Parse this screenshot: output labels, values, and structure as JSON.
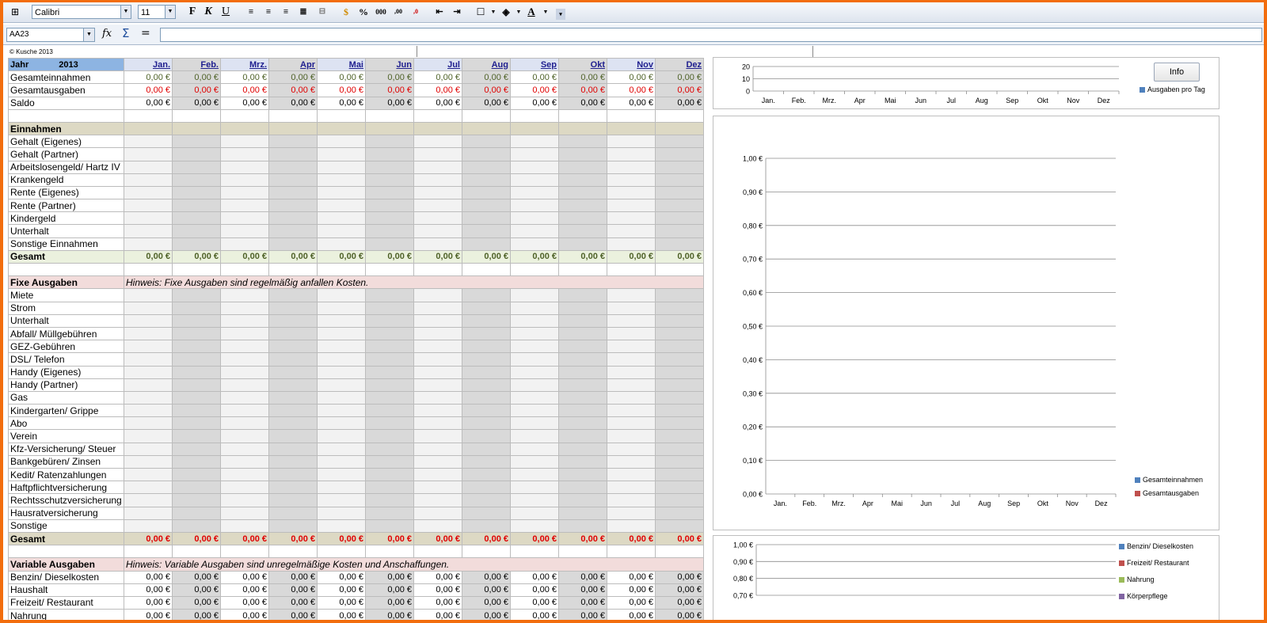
{
  "toolbar": {
    "font_name": "Calibri",
    "font_size": "11",
    "bold": "F",
    "italic": "K",
    "underline": "U"
  },
  "formula_bar": {
    "name_box": "AA23",
    "fx": "fx",
    "sigma": "Σ",
    "equals": "=",
    "formula": ""
  },
  "sheet": {
    "copyright": "© Kusche 2013",
    "year_label": "Jahr",
    "year": "2013",
    "months": [
      "Jan.",
      "Feb.",
      "Mrz.",
      "Apr",
      "Mai",
      "Jun",
      "Jul",
      "Aug",
      "Sep",
      "Okt",
      "Nov",
      "Dez"
    ],
    "zero": "0,00 €",
    "summary": [
      {
        "label": "Gesamteinnahmen",
        "color": "green"
      },
      {
        "label": "Gesamtausgaben",
        "color": "red"
      },
      {
        "label": "Saldo",
        "color": "black"
      }
    ],
    "einnahmen": {
      "title": "Einnahmen",
      "items": [
        "Gehalt (Eigenes)",
        "Gehalt  (Partner)",
        "Arbeitslosengeld/ Hartz IV",
        "Krankengeld",
        "Rente (Eigenes)",
        "Rente (Partner)",
        "Kindergeld",
        "Unterhalt",
        "Sonstige Einnahmen"
      ],
      "total": "Gesamt"
    },
    "fixe": {
      "title": "Fixe Ausgaben",
      "hint": "Hinweis: Fixe Ausgaben sind regelmäßig anfallen Kosten.",
      "items": [
        "Miete",
        "Strom",
        "Unterhalt",
        "Abfall/ Müllgebühren",
        "GEZ-Gebühren",
        "DSL/ Telefon",
        "Handy (Eigenes)",
        "Handy (Partner)",
        "Gas",
        "Kindergarten/ Grippe",
        "Abo",
        "Verein",
        "Kfz-Versicherung/ Steuer",
        "Bankgebüren/ Zinsen",
        "Kedit/ Ratenzahlungen",
        "Haftpflichtversicherung",
        "Rechtsschutzversicherung",
        "Hausratversicherung",
        "Sonstige"
      ],
      "total": "Gesamt"
    },
    "variable": {
      "title": "Variable Ausgaben",
      "hint": "Hinweis: Variable Ausgaben sind unregelmäßige Kosten und Anschaffungen.",
      "items": [
        "Benzin/ Dieselkosten",
        "Haushalt",
        "Freizeit/ Restaurant",
        "Nahrung",
        "Körperpflege"
      ]
    }
  },
  "info_button": "Info",
  "chart_data": [
    {
      "type": "bar",
      "categories": [
        "Jan.",
        "Feb.",
        "Mrz.",
        "Apr",
        "Mai",
        "Jun",
        "Jul",
        "Aug",
        "Sep",
        "Okt",
        "Nov",
        "Dez"
      ],
      "series": [
        {
          "name": "Ausgaben pro Tag",
          "values": [
            0,
            0,
            0,
            0,
            0,
            0,
            0,
            0,
            0,
            0,
            0,
            0
          ],
          "color": "#4f81bd"
        }
      ],
      "yticks": [
        "0",
        "10",
        "20"
      ],
      "ylim": [
        0,
        20
      ],
      "legend": "right"
    },
    {
      "type": "bar",
      "categories": [
        "Jan.",
        "Feb.",
        "Mrz.",
        "Apr",
        "Mai",
        "Jun",
        "Jul",
        "Aug",
        "Sep",
        "Okt",
        "Nov",
        "Dez"
      ],
      "series": [
        {
          "name": "Gesamteinnahmen",
          "values": [
            0,
            0,
            0,
            0,
            0,
            0,
            0,
            0,
            0,
            0,
            0,
            0
          ],
          "color": "#4f81bd"
        },
        {
          "name": "Gesamtausgaben",
          "values": [
            0,
            0,
            0,
            0,
            0,
            0,
            0,
            0,
            0,
            0,
            0,
            0
          ],
          "color": "#c0504d"
        }
      ],
      "yticks": [
        "0,00 €",
        "0,10 €",
        "0,20 €",
        "0,30 €",
        "0,40 €",
        "0,50 €",
        "0,60 €",
        "0,70 €",
        "0,80 €",
        "0,90 €",
        "1,00 €"
      ],
      "ylim": [
        0,
        1
      ],
      "legend": "right"
    },
    {
      "type": "bar",
      "categories": [],
      "series": [
        {
          "name": "Benzin/ Dieselkosten",
          "values": [],
          "color": "#4f81bd"
        },
        {
          "name": "Freizeit/ Restaurant",
          "values": [],
          "color": "#c0504d"
        },
        {
          "name": "Nahrung",
          "values": [],
          "color": "#9bbb59"
        },
        {
          "name": "Körperpflege",
          "values": [],
          "color": "#8064a2"
        }
      ],
      "yticks": [
        "0,70 €",
        "0,80 €",
        "0,90 €",
        "1,00 €"
      ],
      "ylim": [
        0.7,
        1
      ],
      "legend": "right"
    }
  ]
}
